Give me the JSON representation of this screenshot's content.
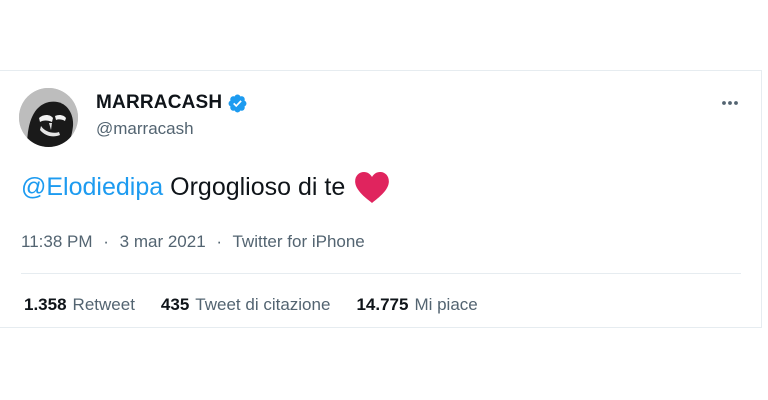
{
  "tweet": {
    "author": {
      "display_name": "MARRACASH",
      "handle": "@marracash",
      "verified": true,
      "avatar_icon": "user-avatar"
    },
    "text": {
      "mention": "@Elodiedipa",
      "body": "Orgoglioso di te",
      "emoji": "heart-icon"
    },
    "meta": {
      "time": "11:38 PM",
      "separator": "·",
      "date": "3 mar 2021",
      "source": "Twitter for iPhone"
    },
    "stats": [
      {
        "count": "1.358",
        "label": "Retweet"
      },
      {
        "count": "435",
        "label": "Tweet di citazione"
      },
      {
        "count": "14.775",
        "label": "Mi piace"
      }
    ]
  },
  "colors": {
    "accent": "#1d9bf0",
    "text": "#0f1419",
    "muted": "#536471",
    "heart": "#e0245e",
    "border": "#e6ecf0"
  }
}
